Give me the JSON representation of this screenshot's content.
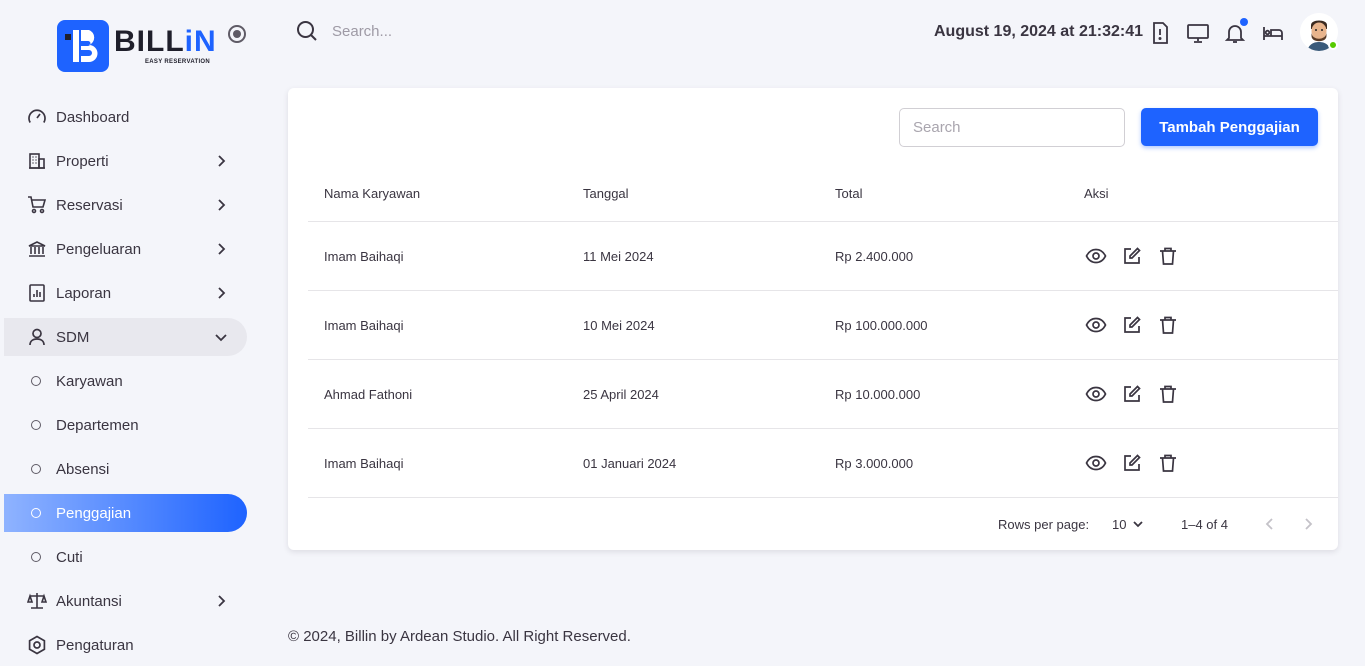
{
  "brand": {
    "name_part1": "BILL",
    "name_part2": "iN",
    "tagline": "EASY RESERVATION",
    "accent": "#1e63ff"
  },
  "header": {
    "search_placeholder": "Search...",
    "datetime": "August 19, 2024 at 21:32:41",
    "icons": [
      "alert-icon",
      "monitor-icon",
      "bell-icon",
      "bed-icon"
    ]
  },
  "sidebar": {
    "items": [
      {
        "label": "Dashboard",
        "icon": "gauge-icon"
      },
      {
        "label": "Properti",
        "icon": "building-icon"
      },
      {
        "label": "Reservasi",
        "icon": "cart-icon"
      },
      {
        "label": "Pengeluaran",
        "icon": "bank-icon"
      },
      {
        "label": "Laporan",
        "icon": "report-icon"
      },
      {
        "label": "SDM",
        "icon": "user-icon"
      }
    ],
    "sdm_sub": [
      {
        "label": "Karyawan"
      },
      {
        "label": "Departemen"
      },
      {
        "label": "Absensi"
      },
      {
        "label": "Penggajian"
      },
      {
        "label": "Cuti"
      }
    ],
    "bottom": [
      {
        "label": "Akuntansi",
        "icon": "scale-icon"
      },
      {
        "label": "Pengaturan",
        "icon": "settings-icon"
      }
    ]
  },
  "main": {
    "search_placeholder": "Search",
    "add_button": "Tambah Penggajian",
    "columns": [
      "Nama Karyawan",
      "Tanggal",
      "Total",
      "Aksi"
    ],
    "rows": [
      {
        "name": "Imam Baihaqi",
        "date": "11 Mei 2024",
        "total": "Rp 2.400.000"
      },
      {
        "name": "Imam Baihaqi",
        "date": "10 Mei 2024",
        "total": "Rp 100.000.000"
      },
      {
        "name": "Ahmad Fathoni",
        "date": "25 April 2024",
        "total": "Rp 10.000.000"
      },
      {
        "name": "Imam Baihaqi",
        "date": "01 Januari 2024",
        "total": "Rp 3.000.000"
      }
    ],
    "pagination": {
      "rows_per_page_label": "Rows per page:",
      "rows_per_page": "10",
      "range": "1–4 of 4"
    }
  },
  "footer": {
    "text": "© 2024, Billin by Ardean Studio. All Right Reserved."
  }
}
